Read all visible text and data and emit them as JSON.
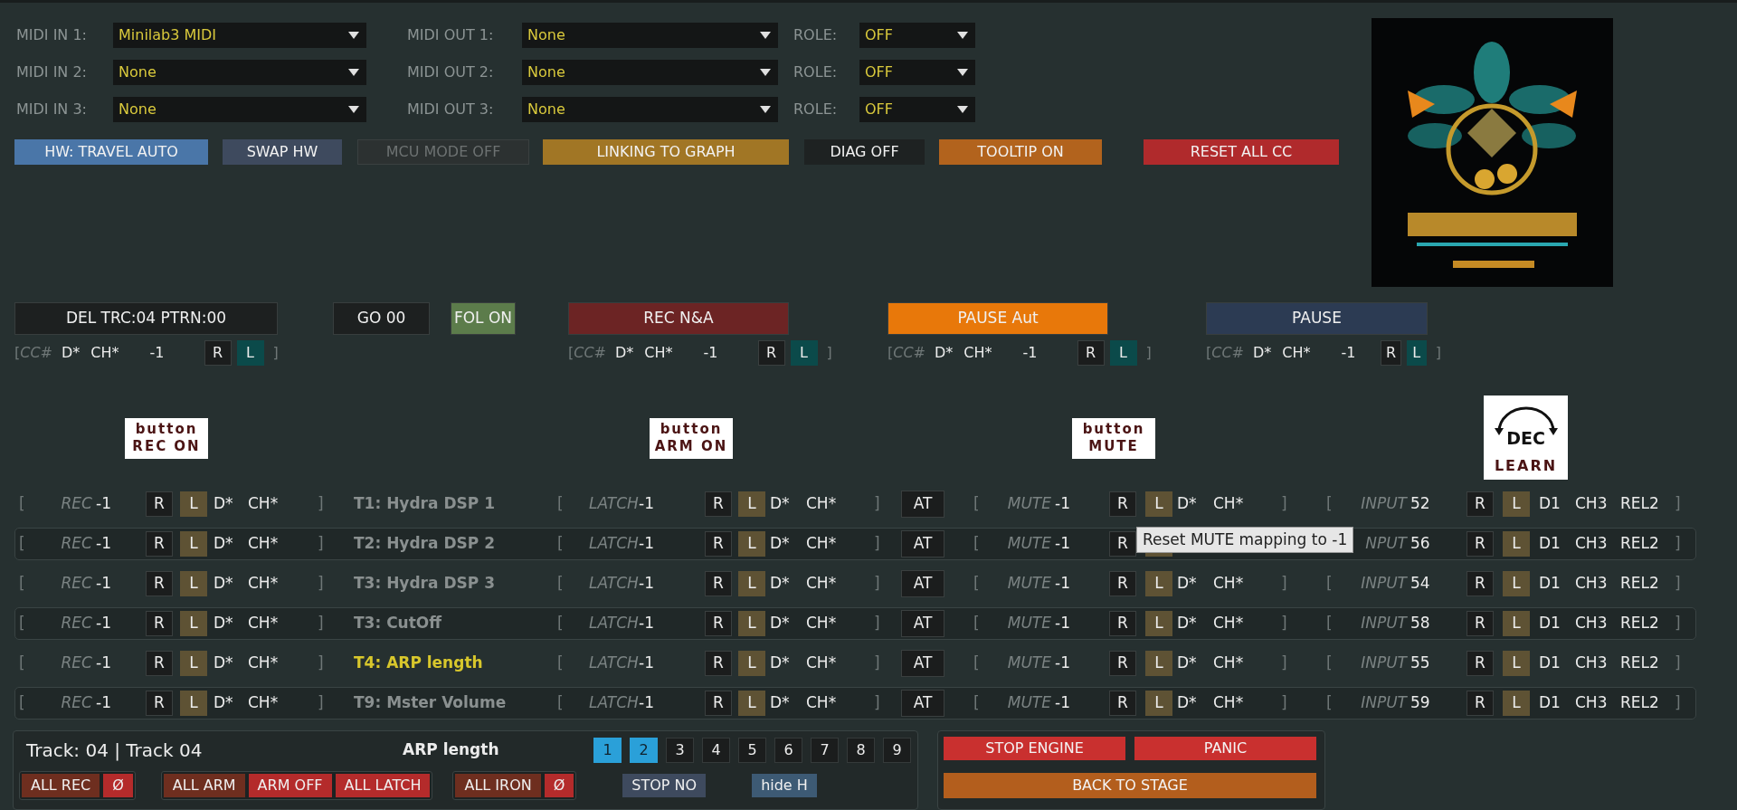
{
  "midi": [
    {
      "in_label": "MIDI IN 1:",
      "in_value": "Minilab3 MIDI",
      "out_label": "MIDI OUT 1:",
      "out_value": "None",
      "role_label": "ROLE:",
      "role_value": "OFF"
    },
    {
      "in_label": "MIDI IN 2:",
      "in_value": "None",
      "out_label": "MIDI OUT 2:",
      "out_value": "None",
      "role_label": "ROLE:",
      "role_value": "OFF"
    },
    {
      "in_label": "MIDI IN 3:",
      "in_value": "None",
      "out_label": "MIDI OUT 3:",
      "out_value": "None",
      "role_label": "ROLE:",
      "role_value": "OFF"
    }
  ],
  "top_buttons": [
    {
      "label": "HW: TRAVEL AUTO",
      "color": "#4a76a8",
      "disabled": false
    },
    {
      "label": "SWAP HW",
      "color": "#3e4a5e",
      "disabled": false
    },
    {
      "label": "MCU MODE OFF",
      "color": "#2c3131",
      "disabled": true
    },
    {
      "label": "LINKING TO GRAPH",
      "color": "#a17625",
      "disabled": false
    },
    {
      "label": "DIAG OFF",
      "color": "#1e2222",
      "disabled": false
    },
    {
      "label": "TOOLTIP ON",
      "color": "#b2631d",
      "disabled": false
    },
    {
      "label": "RESET ALL CC",
      "color": "#b02a2c",
      "disabled": false
    }
  ],
  "transport": [
    {
      "label": "DEL TRC:04 PTRN:00",
      "color": "#1d2020",
      "cc": {
        "open": "[",
        "label": "CC#",
        "dev": "D*",
        "ch": "CH*",
        "value": "-1",
        "reset": "R",
        "learn": "L",
        "close": "]"
      }
    },
    {
      "label": "GO 00",
      "color": "#1d2020"
    },
    {
      "label": "FOL ON",
      "color": "#5c7c4b"
    },
    {
      "label": "REC N&A",
      "color": "#6c2424",
      "cc": {
        "open": "[",
        "label": "CC#",
        "dev": "D*",
        "ch": "CH*",
        "value": "-1",
        "reset": "R",
        "learn": "L",
        "close": "]"
      }
    },
    {
      "label": "PAUSE Aut",
      "color": "#e8780a",
      "cc": {
        "open": "[",
        "label": "CC#",
        "dev": "D*",
        "ch": "CH*",
        "value": "-1",
        "reset": "R",
        "learn": "L",
        "close": "]"
      }
    },
    {
      "label": "PAUSE",
      "color": "#2c3b53",
      "cc": {
        "open": "[",
        "label": "CC#",
        "dev": "D*",
        "ch": "CH*",
        "value": "-1",
        "reset": "R",
        "learn": "L",
        "close": "]"
      }
    }
  ],
  "captions": [
    {
      "kind": "tag",
      "lines": [
        "button",
        "REC ON"
      ]
    },
    {
      "kind": "tag",
      "lines": [
        "button",
        "ARM ON"
      ]
    },
    {
      "kind": "tag",
      "lines": [
        "button",
        "MUTE"
      ]
    },
    {
      "kind": "knob",
      "lines": [
        "DEC",
        "LEARN"
      ]
    }
  ],
  "rows": [
    {
      "rec": {
        "open": "[",
        "label": "REC",
        "value": "-1",
        "reset": "R",
        "learn": "L",
        "dev": "D*",
        "ch": "CH*",
        "close": "]"
      },
      "track": {
        "name": "T1: Hydra DSP 1",
        "selected": false
      },
      "latch": {
        "open": "[",
        "label": "LATCH",
        "value": "-1",
        "reset": "R",
        "learn": "L",
        "dev": "D*",
        "ch": "CH*",
        "close": "]"
      },
      "at": "AT",
      "mute": {
        "open": "[",
        "label": "MUTE",
        "value": "-1",
        "reset": "R",
        "learn": "L",
        "dev": "D*",
        "ch": "CH*",
        "close": "]"
      },
      "input": {
        "open": "[",
        "label": "INPUT",
        "value": "52",
        "reset": "R",
        "learn": "L",
        "dev": "D1",
        "ch": "CH3",
        "rel": "REL2",
        "close": "]"
      }
    },
    {
      "rec": {
        "open": "[",
        "label": "REC",
        "value": "-1",
        "reset": "R",
        "learn": "L",
        "dev": "D*",
        "ch": "CH*",
        "close": "]"
      },
      "track": {
        "name": "T2: Hydra  DSP 2",
        "selected": false
      },
      "latch": {
        "open": "[",
        "label": "LATCH",
        "value": "-1",
        "reset": "R",
        "learn": "L",
        "dev": "D*",
        "ch": "CH*",
        "close": "]"
      },
      "at": "AT",
      "mute": {
        "open": "[",
        "label": "MUTE",
        "value": "-1",
        "reset": "R",
        "tooltip": "Reset MUTE mapping to -1"
      },
      "input": {
        "label": "NPUT",
        "value": "56",
        "reset": "R",
        "learn": "L",
        "dev": "D1",
        "ch": "CH3",
        "rel": "REL2",
        "close": "]"
      }
    },
    {
      "rec": {
        "open": "[",
        "label": "REC",
        "value": "-1",
        "reset": "R",
        "learn": "L",
        "dev": "D*",
        "ch": "CH*",
        "close": "]"
      },
      "track": {
        "name": "T3: Hydra DSP 3",
        "selected": false
      },
      "latch": {
        "open": "[",
        "label": "LATCH",
        "value": "-1",
        "reset": "R",
        "learn": "L",
        "dev": "D*",
        "ch": "CH*",
        "close": "]"
      },
      "at": "AT",
      "mute": {
        "open": "[",
        "label": "MUTE",
        "value": "-1",
        "reset": "R",
        "learn": "L",
        "dev": "D*",
        "ch": "CH*",
        "close": "]"
      },
      "input": {
        "open": "[",
        "label": "INPUT",
        "value": "54",
        "reset": "R",
        "learn": "L",
        "dev": "D1",
        "ch": "CH3",
        "rel": "REL2",
        "close": "]"
      }
    },
    {
      "rec": {
        "open": "[",
        "label": "REC",
        "value": "-1",
        "reset": "R",
        "learn": "L",
        "dev": "D*",
        "ch": "CH*",
        "close": "]"
      },
      "track": {
        "name": "T3: CutOff",
        "selected": false
      },
      "latch": {
        "open": "[",
        "label": "LATCH",
        "value": "-1",
        "reset": "R",
        "learn": "L",
        "dev": "D*",
        "ch": "CH*",
        "close": "]"
      },
      "at": "AT",
      "mute": {
        "open": "[",
        "label": "MUTE",
        "value": "-1",
        "reset": "R",
        "learn": "L",
        "dev": "D*",
        "ch": "CH*",
        "close": "]"
      },
      "input": {
        "open": "[",
        "label": "INPUT",
        "value": "58",
        "reset": "R",
        "learn": "L",
        "dev": "D1",
        "ch": "CH3",
        "rel": "REL2",
        "close": "]"
      }
    },
    {
      "rec": {
        "open": "[",
        "label": "REC",
        "value": "-1",
        "reset": "R",
        "learn": "L",
        "dev": "D*",
        "ch": "CH*",
        "close": "]"
      },
      "track": {
        "name": "T4: ARP length",
        "selected": true
      },
      "latch": {
        "open": "[",
        "label": "LATCH",
        "value": "-1",
        "reset": "R",
        "learn": "L",
        "dev": "D*",
        "ch": "CH*",
        "close": "]"
      },
      "at": "AT",
      "mute": {
        "open": "[",
        "label": "MUTE",
        "value": "-1",
        "reset": "R",
        "learn": "L",
        "dev": "D*",
        "ch": "CH*",
        "close": "]"
      },
      "input": {
        "open": "[",
        "label": "INPUT",
        "value": "55",
        "reset": "R",
        "learn": "L",
        "dev": "D1",
        "ch": "CH3",
        "rel": "REL2",
        "close": "]"
      }
    },
    {
      "rec": {
        "open": "[",
        "label": "REC",
        "value": "-1",
        "reset": "R",
        "learn": "L",
        "dev": "D*",
        "ch": "CH*",
        "close": "]"
      },
      "track": {
        "name": "T9: Mster Volume",
        "selected": false
      },
      "latch": {
        "open": "[",
        "label": "LATCH",
        "value": "-1",
        "reset": "R",
        "learn": "L",
        "dev": "D*",
        "ch": "CH*",
        "close": "]"
      },
      "at": "AT",
      "mute": {
        "open": "[",
        "label": "MUTE",
        "value": "-1",
        "reset": "R",
        "learn": "L",
        "dev": "D*",
        "ch": "CH*",
        "close": "]"
      },
      "input": {
        "open": "[",
        "label": "INPUT",
        "value": "59",
        "reset": "R",
        "learn": "L",
        "dev": "D1",
        "ch": "CH3",
        "rel": "REL2",
        "close": "]"
      }
    }
  ],
  "footer": {
    "track": "Track: 04 | Track 04",
    "title": "ARP length",
    "pages": [
      {
        "label": "1",
        "selected": true
      },
      {
        "label": "2",
        "selected": true
      },
      {
        "label": "3",
        "selected": false
      },
      {
        "label": "4",
        "selected": false
      },
      {
        "label": "5",
        "selected": false
      },
      {
        "label": "6",
        "selected": false
      },
      {
        "label": "7",
        "selected": false
      },
      {
        "label": "8",
        "selected": false
      },
      {
        "label": "9",
        "selected": false
      }
    ],
    "groups": [
      {
        "framed": true,
        "buttons": [
          {
            "label": "ALL REC",
            "color": "#6e2e1f"
          },
          {
            "label": "Ø",
            "color": "#b42b2b"
          }
        ]
      },
      {
        "framed": true,
        "buttons": [
          {
            "label": "ALL ARM",
            "color": "#6e2e1f"
          },
          {
            "label": "ARM OFF",
            "color": "#b42b2b"
          },
          {
            "label": "ALL LATCH",
            "color": "#b42b2b"
          }
        ]
      },
      {
        "framed": true,
        "buttons": [
          {
            "label": "ALL IRON",
            "color": "#6e2e1f"
          },
          {
            "label": "Ø",
            "color": "#b42b2b"
          }
        ]
      },
      {
        "framed": false,
        "buttons": [
          {
            "label": "STOP NO",
            "color": "#3e4a5e"
          }
        ]
      },
      {
        "framed": false,
        "buttons": [
          {
            "label": "hide H",
            "color": "#3d5a74"
          }
        ]
      }
    ],
    "actions": [
      {
        "label": "STOP ENGINE",
        "color": "#c9302f"
      },
      {
        "label": "PANIC",
        "color": "#c9302f"
      },
      {
        "label": "BACK TO STAGE",
        "color": "#b35e1d"
      }
    ]
  }
}
